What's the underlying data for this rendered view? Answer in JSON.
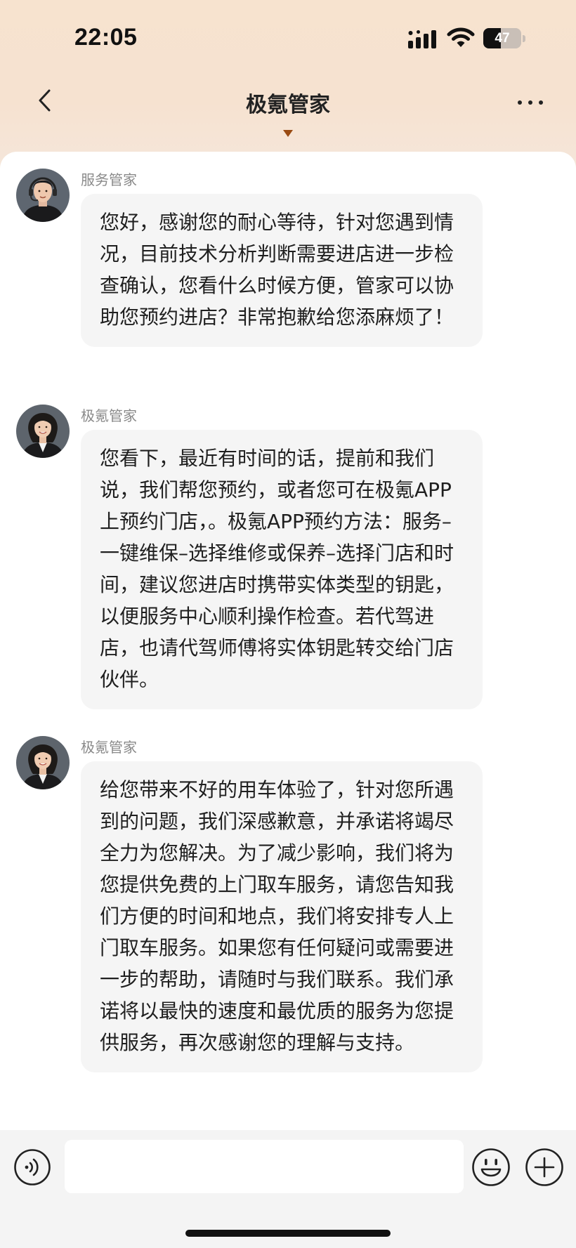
{
  "status_bar": {
    "time": "22:05",
    "battery_level": "47",
    "battery_fraction": 0.47
  },
  "nav": {
    "title": "极氪管家",
    "back_icon": "chevron-left-icon",
    "more_icon": "more-horizontal-icon",
    "caret_icon": "caret-down-icon"
  },
  "messages": [
    {
      "sender": "服务管家",
      "avatar": "male-agent-headset-avatar",
      "text": "您好，感谢您的耐心等待，针对您遇到情况，目前技术分析判断需要进店进一步检查确认，您看什么时候方便，管家可以协助您预约进店？非常抱歉给您添麻烦了！"
    },
    {
      "sender": "极氪管家",
      "avatar": "female-agent-avatar",
      "text": "您看下，最近有时间的话，提前和我们说，我们帮您预约，或者您可在极氪APP上预约门店，。极氪APP预约方法：服务–一键维保–选择维修或保养–选择门店和时间，建议您进店时携带实体类型的钥匙，以便服务中心顺利操作检查。若代驾进店，也请代驾师傅将实体钥匙转交给门店伙伴。"
    },
    {
      "sender": "极氪管家",
      "avatar": "female-agent-avatar",
      "text": "给您带来不好的用车体验了，针对您所遇到的问题，我们深感歉意，并承诺将竭尽全力为您解决。为了减少影响，我们将为您提供免费的上门取车服务，请您告知我们方便的时间和地点，我们将安排专人上门取车服务。如果您有任何疑问或需要进一步的帮助，请随时与我们联系。我们承诺将以最快的速度和最优质的服务为您提供服务，再次感谢您的理解与支持。"
    }
  ],
  "input_bar": {
    "value": "",
    "placeholder": "",
    "voice_icon": "voice-icon",
    "emoji_icon": "emoji-icon",
    "add_icon": "plus-circle-icon"
  },
  "colors": {
    "header_gradient_top": "#f7e3cf",
    "bubble_bg": "#f5f5f5",
    "caret": "#9a4a12",
    "input_bar_bg": "#f4f4f4"
  }
}
